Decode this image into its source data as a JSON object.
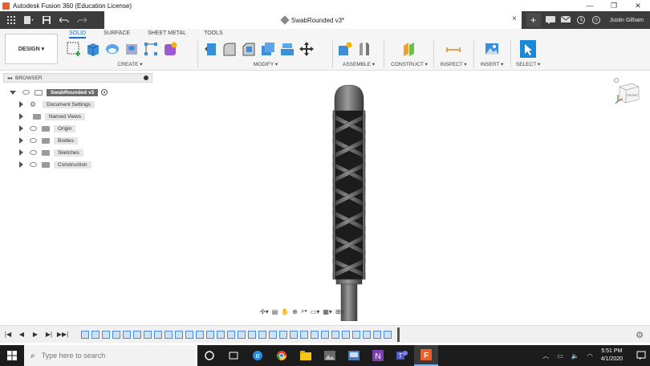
{
  "window": {
    "title": "Autodesk Fusion 360 (Education License)",
    "minimize": "—",
    "maximize": "❐",
    "close": "✕"
  },
  "document_tab": {
    "title": "SwabRounded v3*",
    "close": "×"
  },
  "user": {
    "name": "Justin Gilham"
  },
  "new_tab": "+",
  "workspace": {
    "label": "DESIGN ▾"
  },
  "ribbon_tabs": [
    "SOLID",
    "SURFACE",
    "SHEET METAL",
    "TOOLS"
  ],
  "active_tab": "SOLID",
  "groups": {
    "create": "CREATE ▾",
    "modify": "MODIFY ▾",
    "assemble": "ASSEMBLE ▾",
    "construct": "CONSTRUCT ▾",
    "inspect": "INSPECT ▾",
    "insert": "INSERT ▾",
    "select": "SELECT ▾"
  },
  "browser": {
    "header": "BROWSER",
    "root": "SwabRounded v3",
    "items": [
      {
        "label": "Document Settings",
        "icon": "gear-icon"
      },
      {
        "label": "Named Views",
        "icon": "folder-icon"
      },
      {
        "label": "Origin",
        "icon": "folder-icon"
      },
      {
        "label": "Bodies",
        "icon": "folder-icon"
      },
      {
        "label": "Sketches",
        "icon": "folder-icon"
      },
      {
        "label": "Construction",
        "icon": "folder-icon"
      }
    ]
  },
  "viewcube": {
    "face": "FRONT"
  },
  "taskbar": {
    "search_placeholder": "Type here to search",
    "time": "5:51 PM",
    "date": "4/1/2020"
  },
  "colors": {
    "accent": "#1a73c8",
    "ribbon_bg": "#f5f5f5",
    "dark_bar": "#3c3c3c",
    "taskbar": "#1c1c1c",
    "model": "#5a5a5a"
  }
}
